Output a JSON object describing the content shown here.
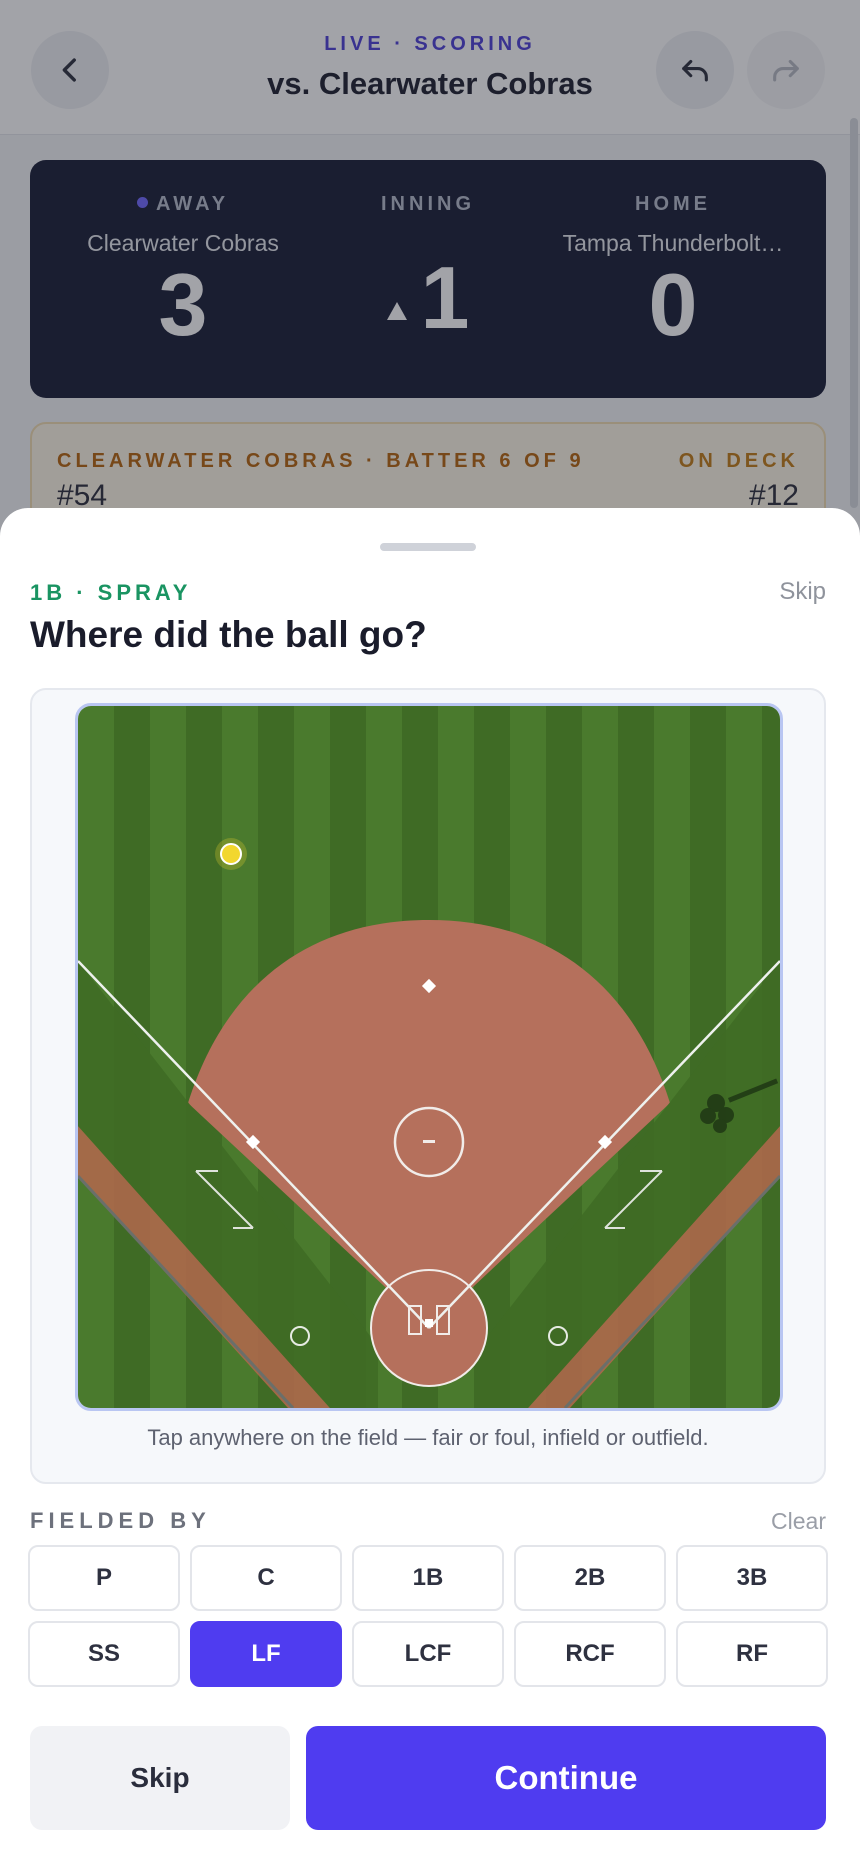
{
  "header": {
    "kicker": "LIVE · SCORING",
    "title": "vs. Clearwater Cobras"
  },
  "scoreboard": {
    "away_label": "AWAY",
    "away_team": "Clearwater Cobras",
    "away_score": "3",
    "inning_label": "INNING",
    "inning": "1",
    "inning_half": "top",
    "home_label": "HOME",
    "home_team": "Tampa Thunderbolt…",
    "home_score": "0"
  },
  "batter": {
    "kicker": "CLEARWATER COBRAS · BATTER 6 OF 9",
    "number": "#54",
    "on_deck_label": "ON DECK",
    "on_deck_number": "#12"
  },
  "sheet": {
    "kicker": "1B · SPRAY",
    "skip_label": "Skip",
    "title": "Where did the ball go?",
    "hint": "Tap anywhere on the field — fair or foul, infield or outfield."
  },
  "fielded_by": {
    "label": "FIELDED BY",
    "clear_label": "Clear",
    "positions": [
      "P",
      "C",
      "1B",
      "2B",
      "3B",
      "SS",
      "LF",
      "LCF",
      "RCF",
      "RF"
    ],
    "selected": "LF"
  },
  "actions": {
    "skip_label": "Skip",
    "continue_label": "Continue"
  },
  "colors": {
    "accent": "#4f3cf0",
    "spray_kicker": "#1a9462",
    "scoreboard_bg": "#161a33",
    "ball_marker": "#f2d72f"
  }
}
